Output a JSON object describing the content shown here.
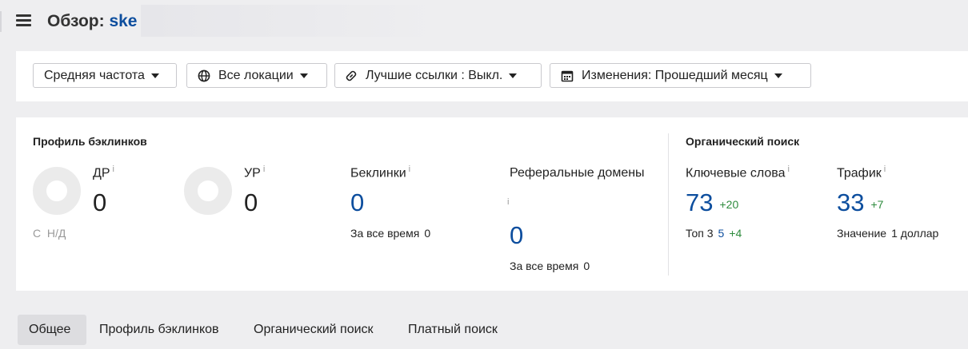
{
  "header": {
    "title_prefix": "Обзор:",
    "target": "ske"
  },
  "filters": {
    "frequency": "Средняя частота",
    "locations": "Все локации",
    "best_links": "Лучшие ссылки : Выкл.",
    "changes": "Изменения: Прошедший месяц"
  },
  "icons": {
    "menu": "hamburger-menu-icon",
    "globe": "globe-icon",
    "link": "link-icon",
    "calendar": "calendar-icon",
    "caret": "caret-down-icon",
    "info": "info-icon"
  },
  "backlink_profile": {
    "title": "Профиль бэклинков",
    "dr": {
      "label": "ДР",
      "value": "0"
    },
    "ur": {
      "label": "УР",
      "value": "0"
    },
    "dr_footnote": {
      "prefix": "С",
      "value": "Н/Д"
    },
    "backlinks": {
      "label": "Беклинки",
      "value": "0",
      "sub_label": "За все время",
      "sub_value": "0"
    },
    "ref_domains": {
      "label": "Реферальные домены",
      "value": "0",
      "sub_label": "За все время",
      "sub_value": "0"
    }
  },
  "organic_search": {
    "title": "Органический поиск",
    "keywords": {
      "label": "Ключевые слова",
      "value": "73",
      "delta": "+20",
      "top3_label": "Топ 3",
      "top3_value": "5",
      "top3_delta": "+4"
    },
    "traffic": {
      "label": "Трафик",
      "value": "33",
      "delta": "+7",
      "worth_label": "Значение",
      "worth_value": "1 доллар"
    }
  },
  "info_glyph": "i",
  "tabs": [
    {
      "label": "Общее",
      "active": true
    },
    {
      "label": "Профиль бэклинков",
      "active": false
    },
    {
      "label": "Органический поиск",
      "active": false
    },
    {
      "label": "Платный поиск",
      "active": false
    }
  ],
  "colors": {
    "accent_blue": "#0d4e9e",
    "positive_green": "#2e8b3d",
    "background": "#eeeef0"
  }
}
